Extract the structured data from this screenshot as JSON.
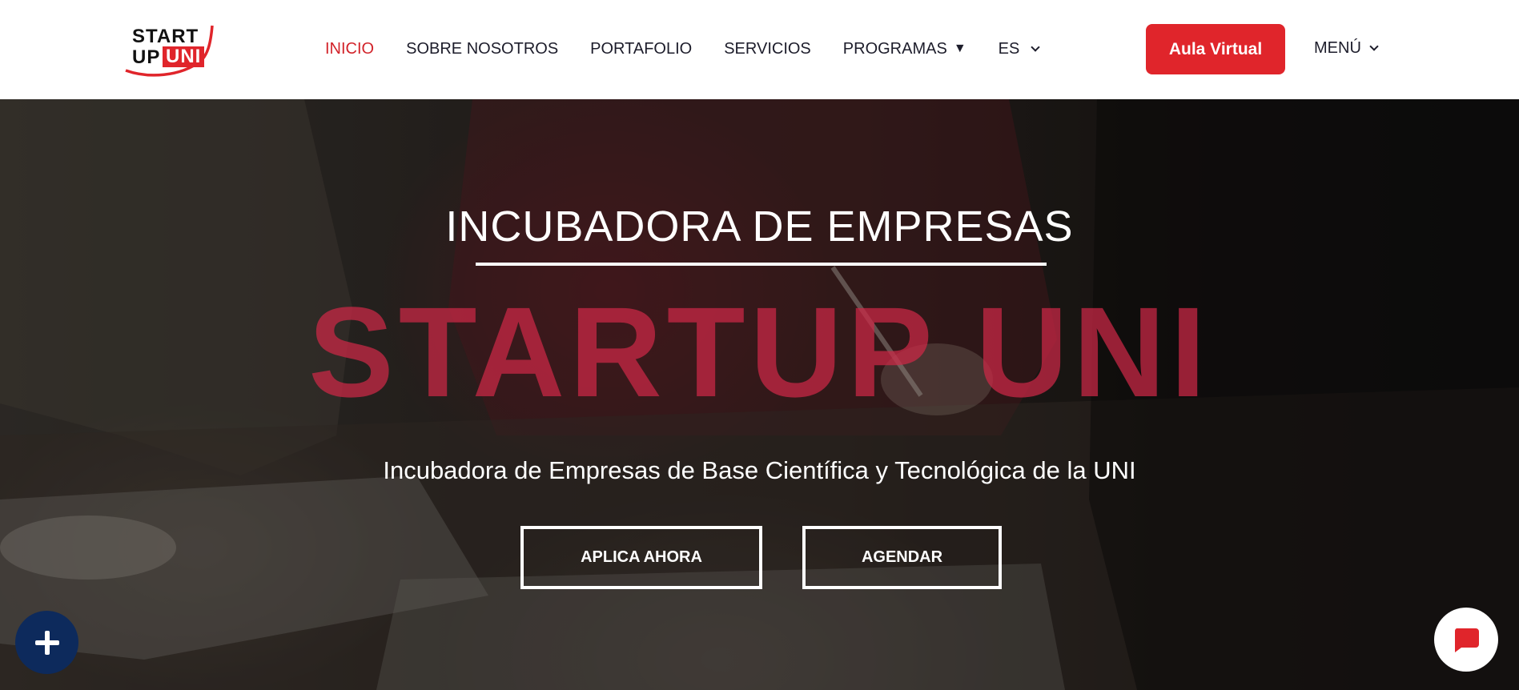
{
  "header": {
    "logo": {
      "line1": "START",
      "line2_prefix": "UP",
      "line2_highlight": "UNI"
    },
    "nav": [
      {
        "label": "INICIO",
        "active": true
      },
      {
        "label": "SOBRE NOSOTROS"
      },
      {
        "label": "PORTAFOLIO"
      },
      {
        "label": "SERVICIOS"
      },
      {
        "label": "PROGRAMAS",
        "icon": "caret-down-solid-icon"
      },
      {
        "label": "ES",
        "icon": "chevron-down-icon"
      }
    ],
    "cta_label": "Aula Virtual",
    "menu_label": "MENÚ",
    "accent_color": "#e0252b"
  },
  "hero": {
    "kicker": "INCUBADORA DE EMPRESAS",
    "title": "STARTUP UNI",
    "subtitle": "Incubadora de Empresas de Base Científica y Tecnológica de la UNI",
    "buttons": [
      {
        "label": "APLICA AHORA"
      },
      {
        "label": "AGENDAR"
      }
    ]
  },
  "floating": {
    "left_button_icon": "plus-icon",
    "left_button_color": "#0d2a5c",
    "right_button_icon": "chat-bubble-icon",
    "right_button_icon_color": "#e0252b"
  }
}
